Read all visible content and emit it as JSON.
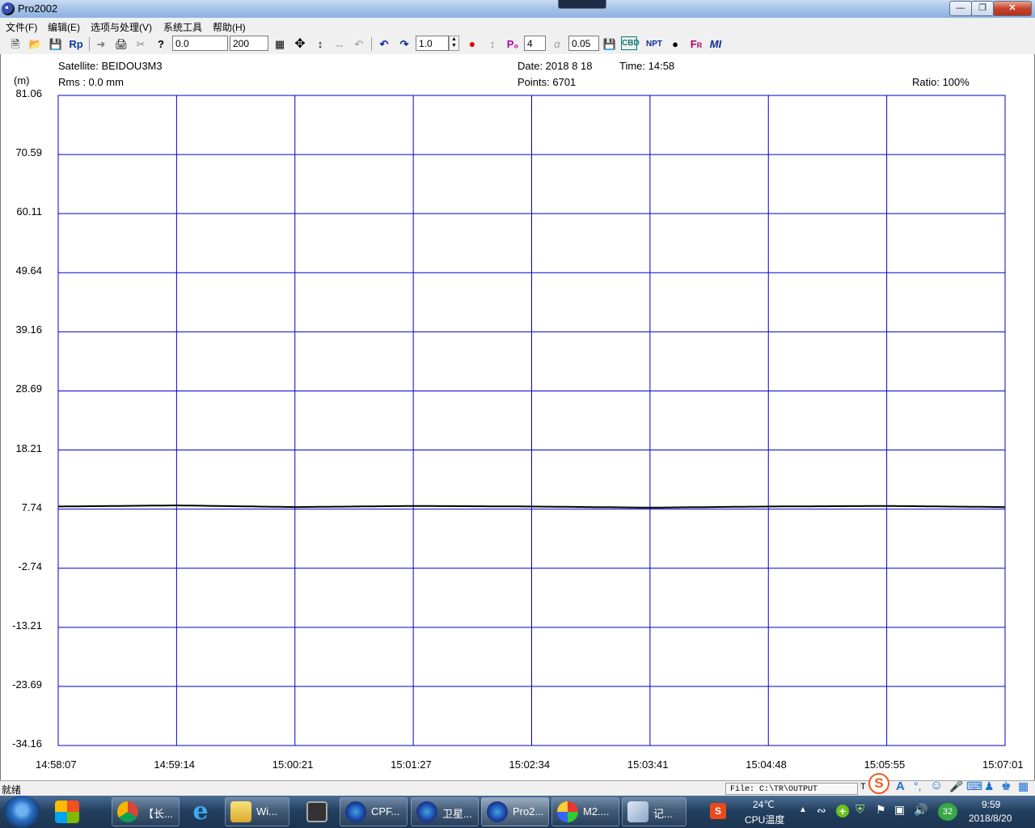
{
  "window": {
    "title": "Pro2002"
  },
  "menu": [
    "文件(F)",
    "编辑(E)",
    "选项与处理(V)",
    "系统工具",
    "帮助(H)"
  ],
  "toolbar": {
    "field_start": "0.0",
    "field_count": "200",
    "field_scale": "1.0",
    "field_p": "4",
    "field_ratio": "0.05",
    "rp_label": "Rp"
  },
  "info": {
    "satellite": "Satellite: BEIDOU3M3",
    "rms": "Rms :  0.0 mm",
    "date": "Date: 2018  8 18",
    "time": "Time: 14:58",
    "points": "Points:  6701",
    "ratio": "Ratio: 100%",
    "unit": "(m)"
  },
  "chart_data": {
    "type": "line",
    "ylabel": "(m)",
    "ylim": [
      -34.16,
      81.06
    ],
    "yticks": [
      "81.06",
      "70.59",
      "60.11",
      "49.64",
      "39.16",
      "28.69",
      "18.21",
      "7.74",
      "-2.74",
      "-13.21",
      "-23.69",
      "-34.16"
    ],
    "xticks": [
      "14:58:07",
      "14:59:14",
      "15:00:21",
      "15:01:27",
      "15:02:34",
      "15:03:41",
      "15:04:48",
      "15:05:55",
      "15:07:01"
    ],
    "series": [
      {
        "values": [
          8.2,
          8.4,
          8.1,
          8.3,
          8.2,
          8.0,
          8.2,
          8.3,
          8.1
        ]
      }
    ],
    "grid": true,
    "grid_color": "#0000cc",
    "line_color": "#000000"
  },
  "status": {
    "ready": "就绪",
    "file": "File: C:\\TR\\OUTPUT",
    "extra": "T"
  },
  "taskbar": {
    "items": [
      {
        "label": "【长...",
        "icon": "chrome-icon"
      },
      {
        "label": "",
        "icon": "ie-icon"
      },
      {
        "label": "Wi...",
        "icon": "folder-icon"
      },
      {
        "label": "",
        "icon": "camera-icon"
      },
      {
        "label": "CPF...",
        "icon": "globe-icon"
      },
      {
        "label": "卫星...",
        "icon": "globe-icon"
      },
      {
        "label": "Pro2...",
        "icon": "globe-icon"
      },
      {
        "label": "M2....",
        "icon": "paint-icon"
      },
      {
        "label": "记...",
        "icon": "notepad-icon"
      }
    ],
    "weather_temp": "24℃",
    "weather_label": "CPU温度",
    "badge": "32",
    "clock_time": "9:59",
    "clock_date": "2018/8/20"
  }
}
